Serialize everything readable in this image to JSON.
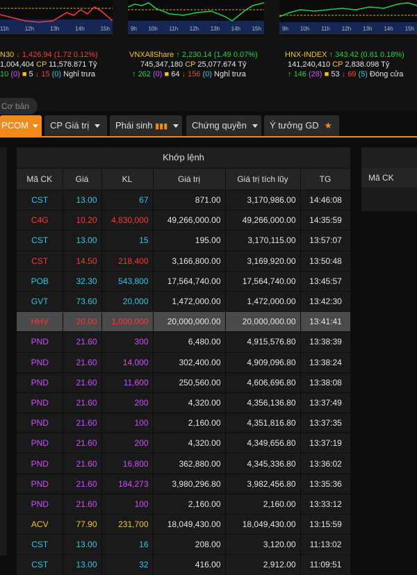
{
  "header": {
    "axis_ticks": [
      "9h",
      "10h",
      "11h",
      "12h",
      "13h",
      "14h",
      "15h"
    ],
    "indices": [
      {
        "name": "N30",
        "value": "1,426.94",
        "change": "(1.72 0.12%)",
        "trend": "down",
        "volume": "1,004,404",
        "cp_label": "CP",
        "cp_value": "11,578.871 Tỷ",
        "advance": "10",
        "ref_open": "(0)",
        "ref_count": "5",
        "decline": "15",
        "decline_paren": "(0)",
        "status": "Nghỉ trưa"
      },
      {
        "name": "VNXAllShare",
        "value": "2,230.14",
        "change": "(1.49 0.07%)",
        "trend": "up",
        "volume": "745,347,180",
        "cp_label": "CP",
        "cp_value": "25,077.674 Tỷ",
        "advance": "262",
        "ref_open": "(0)",
        "ref_count": "64",
        "decline": "156",
        "decline_paren": "(0)",
        "status": "Nghỉ trưa"
      },
      {
        "name": "HNX-INDEX",
        "value": "343.42",
        "change": "(0.61 0.18%)",
        "trend": "up",
        "volume": "141,240,410",
        "cp_label": "CP",
        "cp_value": "2,838.098 Tỷ",
        "advance": "146",
        "ref_open": "(28)",
        "ref_count": "53",
        "decline": "69",
        "decline_paren": "(5)",
        "status": "Đóng cửa"
      }
    ]
  },
  "nav": {
    "basic_label": "Cơ bản",
    "tabs": [
      {
        "label": "PCOM",
        "active": true
      },
      {
        "label": "CP Giá trị"
      },
      {
        "label": "Phái sinh"
      },
      {
        "label": "Chứng quyền"
      },
      {
        "label": "Ý tưởng GD"
      }
    ]
  },
  "colors": {
    "up": "#1fd24a",
    "down": "#ff3838",
    "ref": "#f5c518",
    "purple": "#d04cff",
    "cyan": "#2fc7e5",
    "accent": "#f08a1c"
  },
  "match_table": {
    "title": "Khớp lệnh",
    "columns": [
      "Mã CK",
      "Giá",
      "KL",
      "Giá trị",
      "Giá trị tích lũy",
      "TG"
    ],
    "rows": [
      {
        "code": "CST",
        "price": "13.00",
        "qty": "67",
        "value": "871.00",
        "cum": "3,170,986.00",
        "time": "14:46:08",
        "color": "cyan"
      },
      {
        "code": "C4G",
        "price": "10.20",
        "qty": "4,830,000",
        "value": "49,266,000.00",
        "cum": "49,266,000.00",
        "time": "14:35:59",
        "color": "down"
      },
      {
        "code": "CST",
        "price": "13.00",
        "qty": "15",
        "value": "195.00",
        "cum": "3,170,115.00",
        "time": "13:57:07",
        "color": "cyan"
      },
      {
        "code": "CST",
        "price": "14.50",
        "qty": "218,400",
        "value": "3,166,800.00",
        "cum": "3,169,920.00",
        "time": "13:50:48",
        "color": "down"
      },
      {
        "code": "POB",
        "price": "32.30",
        "qty": "543,800",
        "value": "17,564,740.00",
        "cum": "17,564,740.00",
        "time": "13:45:57",
        "color": "cyan"
      },
      {
        "code": "GVT",
        "price": "73.60",
        "qty": "20,000",
        "value": "1,472,000.00",
        "cum": "1,472,000.00",
        "time": "13:42:30",
        "color": "cyan"
      },
      {
        "code": "HHV",
        "price": "20.00",
        "qty": "1,000,000",
        "value": "20,000,000.00",
        "cum": "20,000,000.00",
        "time": "13:41:41",
        "color": "down",
        "highlight": true
      },
      {
        "code": "PND",
        "price": "21.60",
        "qty": "300",
        "value": "6,480.00",
        "cum": "4,915,576.80",
        "time": "13:38:39",
        "color": "purple"
      },
      {
        "code": "PND",
        "price": "21.60",
        "qty": "14,000",
        "value": "302,400.00",
        "cum": "4,909,096.80",
        "time": "13:38:24",
        "color": "purple"
      },
      {
        "code": "PND",
        "price": "21.60",
        "qty": "11,600",
        "value": "250,560.00",
        "cum": "4,606,696.80",
        "time": "13:38:08",
        "color": "purple"
      },
      {
        "code": "PND",
        "price": "21.60",
        "qty": "200",
        "value": "4,320.00",
        "cum": "4,356,136.80",
        "time": "13:37:49",
        "color": "purple"
      },
      {
        "code": "PND",
        "price": "21.60",
        "qty": "100",
        "value": "2,160.00",
        "cum": "4,351,816.80",
        "time": "13:37:35",
        "color": "purple"
      },
      {
        "code": "PND",
        "price": "21.60",
        "qty": "200",
        "value": "4,320.00",
        "cum": "4,349,656.80",
        "time": "13:37:19",
        "color": "purple"
      },
      {
        "code": "PND",
        "price": "21.60",
        "qty": "16,800",
        "value": "362,880.00",
        "cum": "4,345,336.80",
        "time": "13:36:02",
        "color": "purple"
      },
      {
        "code": "PND",
        "price": "21.60",
        "qty": "184,273",
        "value": "3,980,296.80",
        "cum": "3,982,456.80",
        "time": "13:35:36",
        "color": "purple"
      },
      {
        "code": "PND",
        "price": "21.60",
        "qty": "100",
        "value": "2,160.00",
        "cum": "2,160.00",
        "time": "13:33:12",
        "color": "purple"
      },
      {
        "code": "ACV",
        "price": "77.90",
        "qty": "231,700",
        "value": "18,049,430.00",
        "cum": "18,049,430.00",
        "time": "13:15:59",
        "color": "ref"
      },
      {
        "code": "CST",
        "price": "13.00",
        "qty": "16",
        "value": "208.00",
        "cum": "3,120.00",
        "time": "11:13:02",
        "color": "cyan"
      },
      {
        "code": "CST",
        "price": "13.00",
        "qty": "32",
        "value": "416.00",
        "cum": "2,912.00",
        "time": "11:09:51",
        "color": "cyan"
      }
    ]
  },
  "right_panel": {
    "header": "Mã CK"
  }
}
